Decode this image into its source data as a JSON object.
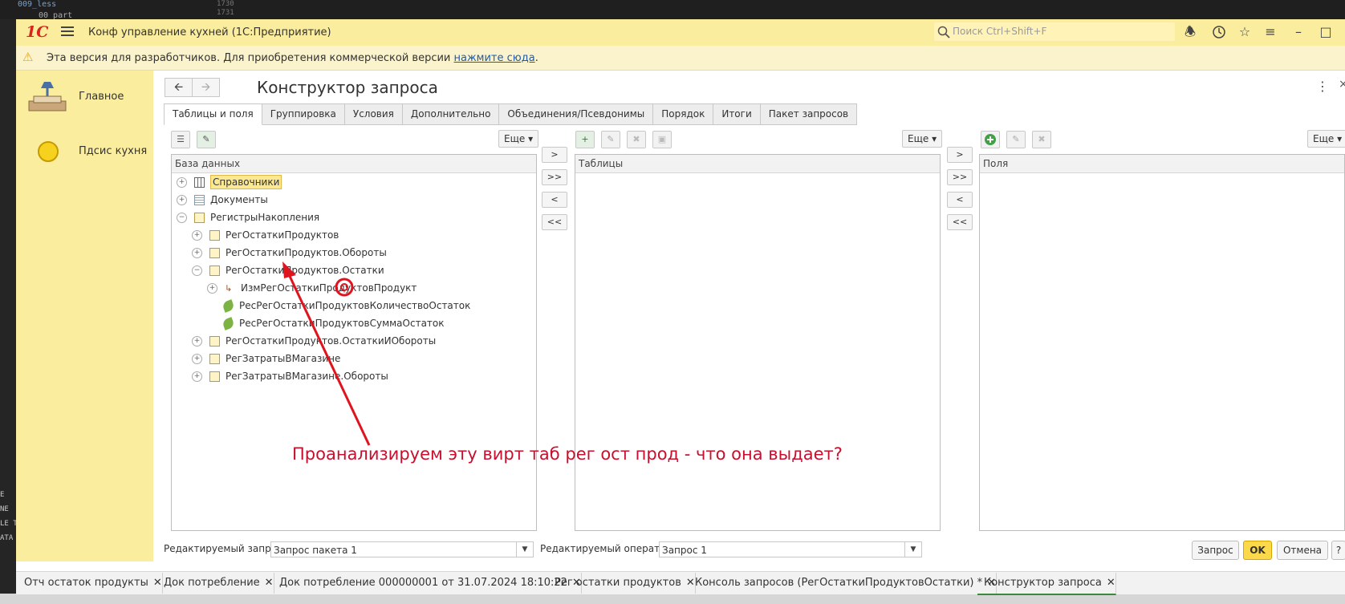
{
  "ide": {
    "tree_item_1": "009_less",
    "tree_item_2": "00_part",
    "line_1": "1730",
    "line_2": "1731",
    "side_labels": [
      "E",
      "NE",
      "LE TA",
      "ATA"
    ]
  },
  "app": {
    "title": "Конф управление кухней  (1С:Предприятие)",
    "logo": "1С",
    "search_placeholder": "Поиск Ctrl+Shift+F"
  },
  "warning": {
    "text": "Эта версия для разработчиков. Для приобретения коммерческой версии ",
    "link": "нажмите сюда",
    "suffix": "."
  },
  "sidebar": {
    "items": [
      {
        "label": "Главное"
      },
      {
        "label": "Пдсис кухня"
      }
    ]
  },
  "page": {
    "title": "Конструктор запроса"
  },
  "tabs": [
    "Таблицы и поля",
    "Группировка",
    "Условия",
    "Дополнительно",
    "Объединения/Псевдонимы",
    "Порядок",
    "Итоги",
    "Пакет запросов"
  ],
  "panels": {
    "more_label": "Еще",
    "database_header": "База данных",
    "tables_header": "Таблицы",
    "fields_header": "Поля",
    "move_buttons": [
      ">",
      ">>",
      "<",
      "<<"
    ]
  },
  "tree": [
    {
      "label": "Справочники",
      "icon": "catalog-icon",
      "expand": "plus"
    },
    {
      "label": "Документы",
      "icon": "document-icon",
      "expand": "plus"
    },
    {
      "label": "РегистрыНакопления",
      "icon": "register-icon",
      "expand": "minus"
    },
    {
      "label": "РегОстаткиПродуктов",
      "icon": "register-icon",
      "expand": "plus"
    },
    {
      "label": "РегОстаткиПродуктов.Обороты",
      "icon": "register-icon",
      "expand": "plus"
    },
    {
      "label": "РегОстаткиПродуктов.Остатки",
      "icon": "register-icon",
      "expand": "minus"
    },
    {
      "label": "ИзмРегОстаткиПродуктовПродукт",
      "icon": "dimension-icon",
      "expand": "plus"
    },
    {
      "label": "РесРегОстаткиПродуктовКоличествоОстаток",
      "icon": "resource-icon",
      "expand": ""
    },
    {
      "label": "РесРегОстаткиПродуктовСуммаОстаток",
      "icon": "resource-icon",
      "expand": ""
    },
    {
      "label": "РегОстаткиПродуктов.ОстаткиИОбороты",
      "icon": "register-icon",
      "expand": "plus"
    },
    {
      "label": "РегЗатратыВМагазине",
      "icon": "register-icon",
      "expand": "plus"
    },
    {
      "label": "РегЗатратыВМагазине.Обороты",
      "icon": "register-icon",
      "expand": "plus"
    }
  ],
  "footer": {
    "edited_query_label": "Редактируемый запрос:",
    "edited_query_value": "Запрос пакета 1",
    "edited_operator_label": "Редактируемый оператор:",
    "edited_operator_value": "Запрос 1",
    "query_button": "Запрос",
    "ok_button": "OK",
    "cancel_button": "Отмена",
    "help_button": "?"
  },
  "bottom_tabs": [
    "Отч остаток продукты",
    "Док потребление",
    "Док потребление 000000001 от 31.07.2024 18:10:22",
    "Рег остатки продуктов",
    "Консоль запросов (РегОстаткиПродуктовОстатки) *",
    "Конструктор запроса"
  ],
  "annotation": {
    "text": "Проанализируем эту вирт таб рег ост прод - что она выдает?",
    "color": "#c8102e"
  },
  "colors": {
    "title_bar": "#fbed9e",
    "accent_green": "#3a8a3a",
    "ok_button": "#fbd94b"
  }
}
